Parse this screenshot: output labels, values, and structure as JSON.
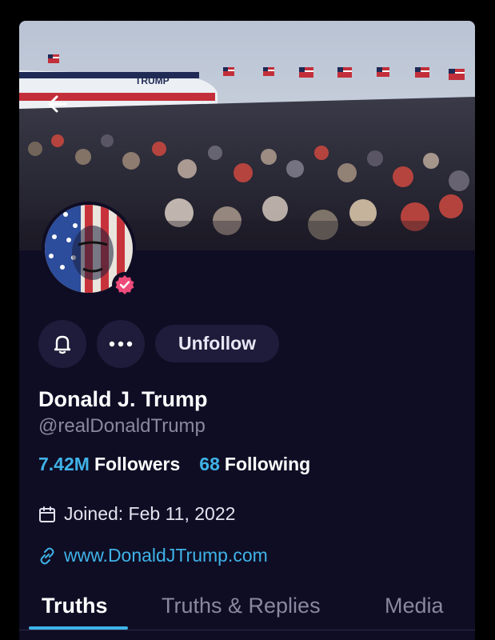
{
  "profile": {
    "name": "Donald J. Trump",
    "handle": "@realDonaldTrump",
    "verified": true
  },
  "banner": {
    "plane_text": "TRUMP",
    "back_icon": "arrow-left-icon"
  },
  "actions": {
    "bell_icon": "bell-icon",
    "more_icon": "ellipsis-icon",
    "unfollow_label": "Unfollow"
  },
  "stats": {
    "followers_count": "7.42M",
    "followers_label": "Followers",
    "following_count": "68",
    "following_label": "Following"
  },
  "details": {
    "joined": "Joined: Feb 11, 2022",
    "website": "www.DonaldJTrump.com"
  },
  "tabs": [
    {
      "label": "Truths",
      "active": true
    },
    {
      "label": "Truths & Replies",
      "active": false
    },
    {
      "label": "Media",
      "active": false
    }
  ],
  "colors": {
    "background": "#0f0d24",
    "accent": "#3fb3e8",
    "button_bg": "#1e1c3a",
    "verified_badge": "#ee4b7a"
  }
}
